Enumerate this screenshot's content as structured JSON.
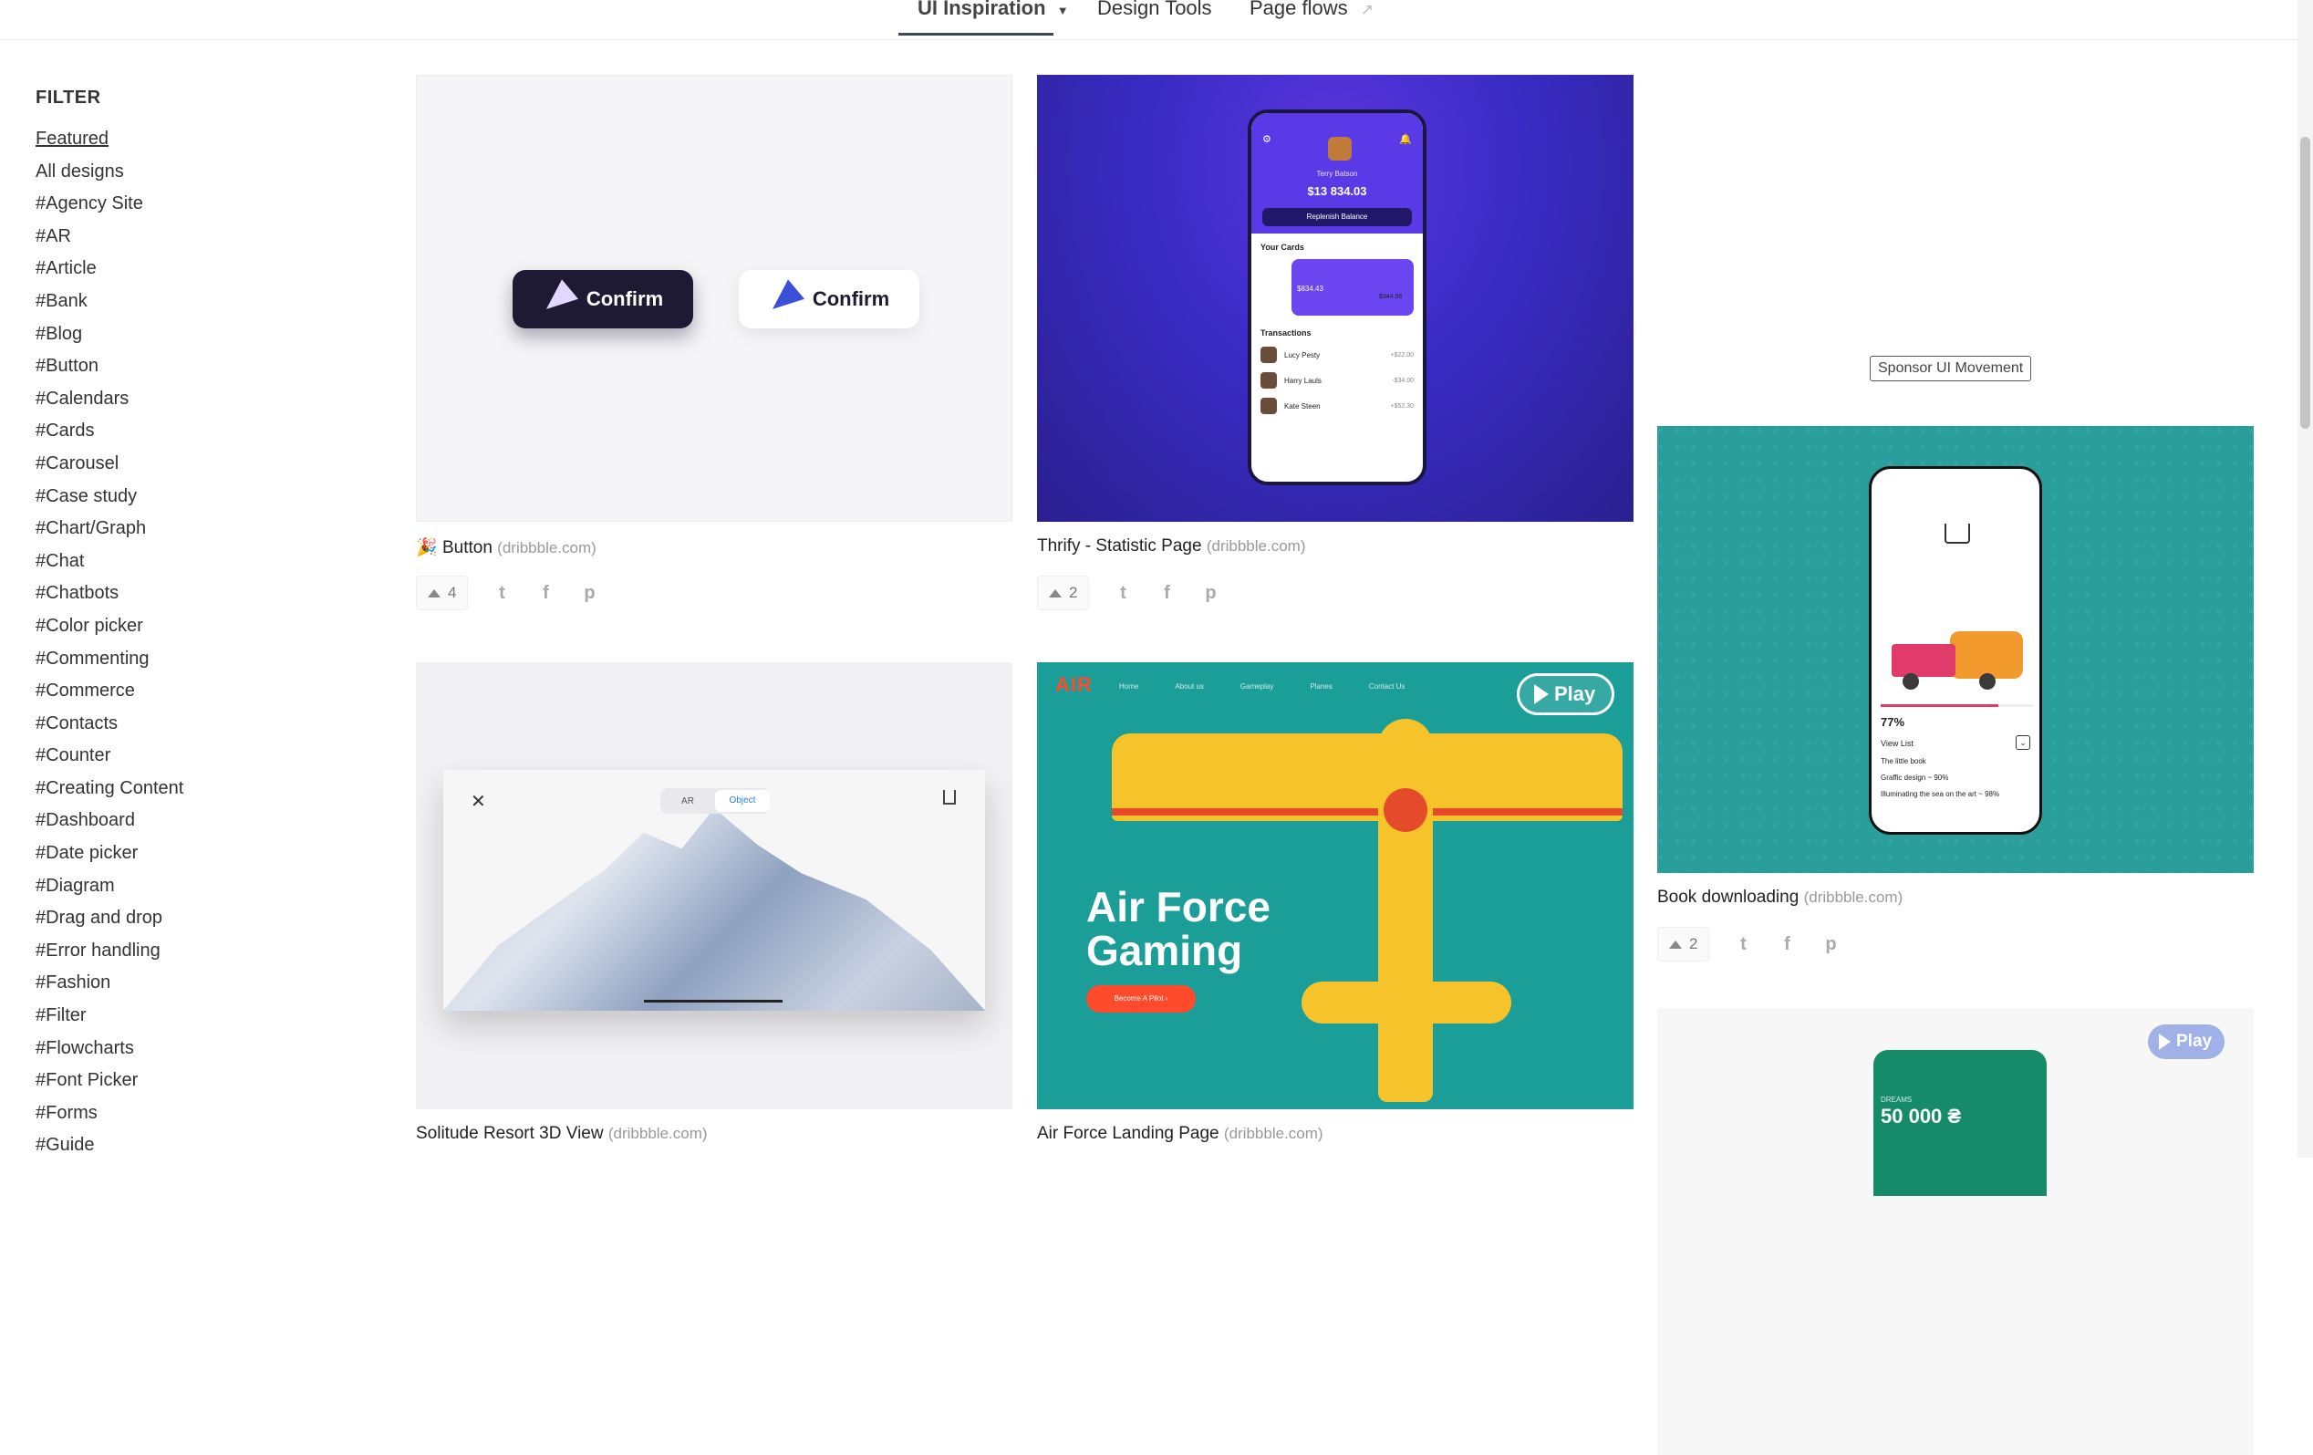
{
  "nav": {
    "items": [
      {
        "label": "UI Inspiration",
        "active": true,
        "has_dropdown": true
      },
      {
        "label": "Design Tools"
      },
      {
        "label": "Page flows",
        "external": true
      }
    ]
  },
  "sidebar": {
    "title": "FILTER",
    "items": [
      "Featured",
      "All designs",
      "#Agency Site",
      "#AR",
      "#Article",
      "#Bank",
      "#Blog",
      "#Button",
      "#Calendars",
      "#Cards",
      "#Carousel",
      "#Case study",
      "#Chart/Graph",
      "#Chat",
      "#Chatbots",
      "#Color picker",
      "#Commenting",
      "#Commerce",
      "#Contacts",
      "#Counter",
      "#Creating Content",
      "#Dashboard",
      "#Date picker",
      "#Diagram",
      "#Drag and drop",
      "#Error handling",
      "#Fashion",
      "#Filter",
      "#Flowcharts",
      "#Font Picker",
      "#Forms",
      "#Guide"
    ],
    "active_index": 0
  },
  "cards": [
    {
      "title": "Button",
      "emoji": "🎉",
      "source": "(dribbble.com)",
      "votes": "4",
      "thumb": {
        "button_dark": "Confirm",
        "button_light": "Confirm"
      }
    },
    {
      "title": "Thrify - Statistic Page",
      "source": "(dribbble.com)",
      "votes": "2",
      "thumb": {
        "name": "Terry Batson",
        "balance": "$13 834.03",
        "replenish": "Replenish Balance",
        "your_cards": "Your Cards",
        "card_amount": "$834.43",
        "card2_amount": "$344.56",
        "transactions": "Transactions",
        "tx": [
          {
            "name": "Lucy Pesty",
            "amt": "+$22.00"
          },
          {
            "name": "Harry Lauls",
            "amt": "-$34.00"
          },
          {
            "name": "Kate Steen",
            "amt": "+$52.30"
          }
        ]
      }
    },
    {
      "title": "Book downloading",
      "source": "(dribbble.com)",
      "votes": "2",
      "thumb": {
        "percent": "77%",
        "percent_value": 77,
        "view_list": "View List",
        "rows": [
          "The little book",
          "Graffic design ~ 90%",
          "Illuminating the sea on the art ~ 98%"
        ]
      }
    },
    {
      "title": "Solitude Resort 3D View",
      "source": "(dribbble.com)",
      "thumb": {
        "seg_left": "AR",
        "seg_right": "Object"
      }
    },
    {
      "title": "Air Force Landing Page",
      "source": "(dribbble.com)",
      "thumb": {
        "logo": "AIR",
        "nav": [
          "Home",
          "About us",
          "Gameplay",
          "Planes",
          "Contact Us"
        ],
        "headline_1": "Air Force",
        "headline_2": "Gaming",
        "cta": "Become A Pilot  ›",
        "play": "Play"
      }
    },
    {
      "title": "",
      "source": "",
      "thumb": {
        "label": "DREAMS",
        "amount": "50 000 ₴",
        "play": "Play"
      }
    }
  ],
  "sponsor": "Sponsor UI Movement"
}
